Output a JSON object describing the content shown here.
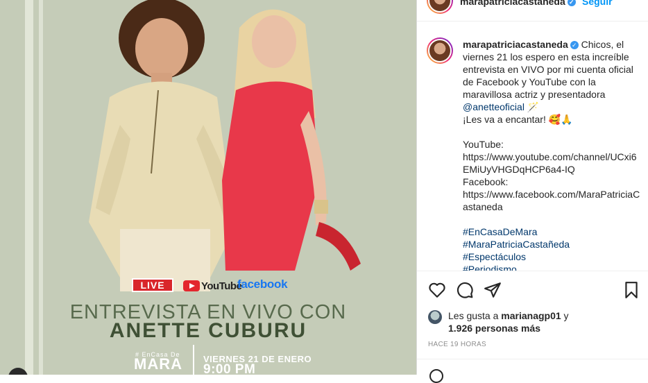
{
  "post": {
    "badges": {
      "live": "LIVE",
      "youtube": "YouTube",
      "facebook": "facebook"
    },
    "headline": "ENTREVISTA EN VIVO CON",
    "guest": "ANETTE CUBURU",
    "brand_hashtag": "# EnCasa De",
    "brand_name": "MARA",
    "date": "VIERNES 21 DE ENERO",
    "time": "9:00 PM"
  },
  "header": {
    "username": "marapatriciacastaneda",
    "follow": "Seguir"
  },
  "caption": {
    "username": "marapatriciacastaneda",
    "text_intro": "Chicos, el viernes 21 los espero en esta increíble entrevista en VIVO por mi cuenta oficial de Facebook y YouTube con la maravillosa actriz y presentadora",
    "mention": "@anetteoficial",
    "emoji1": "🪄",
    "line2": "¡Les va a encantar!",
    "emoji2": "🥰🙏",
    "youtube_label": "YouTube:",
    "youtube_url": "https://www.youtube.com/channel/UCxi6EMiUyVHGDqHCP6a4-IQ",
    "facebook_label": "Facebook:",
    "facebook_url": "https://www.facebook.com/MaraPatriciaCastaneda",
    "hashtags": [
      "#EnCasaDeMara",
      "#MaraPatriciaCastañeda",
      "#Espectáculos",
      "#Periodismo"
    ]
  },
  "likes": {
    "prefix": "Les gusta a ",
    "user": "marianagp01",
    "suffix": " y",
    "count": "1.926 personas más"
  },
  "timestamp": "HACE 19 HORAS",
  "colors": {
    "background_green": "#c5ccb8",
    "accent_blue": "#0095f6",
    "link_blue": "#00376b",
    "live_red": "#d9262b"
  }
}
